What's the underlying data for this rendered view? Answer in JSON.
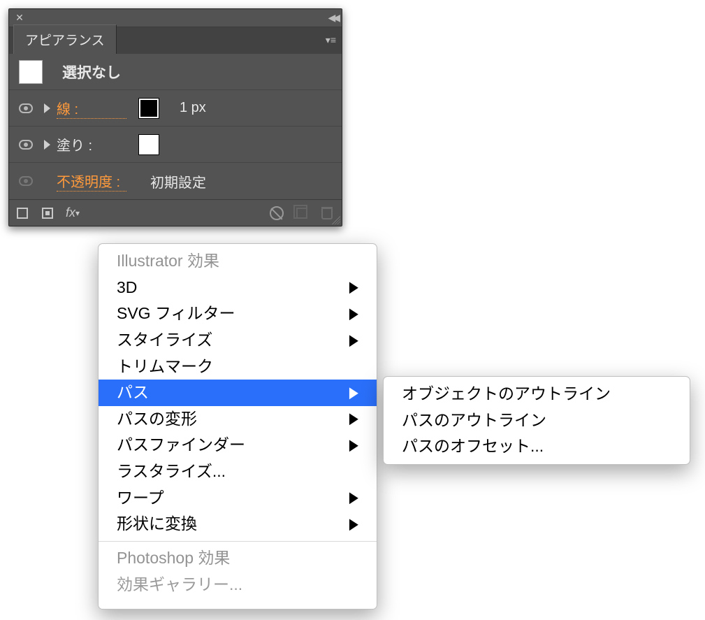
{
  "panel": {
    "tab_label": "アピアランス",
    "selection_label": "選択なし",
    "stroke": {
      "label": "線 :",
      "value": "1 px"
    },
    "fill": {
      "label": "塗り :"
    },
    "opacity": {
      "label": "不透明度 :",
      "value": "初期設定"
    },
    "fx_label": "fx"
  },
  "menu": {
    "section1_header": "Illustrator 効果",
    "items1": [
      {
        "label": "3D",
        "arrow": true
      },
      {
        "label": "SVG フィルター",
        "arrow": true
      },
      {
        "label": "スタイライズ",
        "arrow": true
      },
      {
        "label": "トリムマーク",
        "arrow": false
      },
      {
        "label": "パス",
        "arrow": true,
        "selected": true
      },
      {
        "label": "パスの変形",
        "arrow": true
      },
      {
        "label": "パスファインダー",
        "arrow": true
      },
      {
        "label": "ラスタライズ...",
        "arrow": false
      },
      {
        "label": "ワープ",
        "arrow": true
      },
      {
        "label": "形状に変換",
        "arrow": true
      }
    ],
    "section2_header": "Photoshop 効果",
    "items2": [
      {
        "label": "効果ギャラリー...",
        "arrow": false,
        "dim": true
      }
    ]
  },
  "submenu": {
    "items": [
      {
        "label": "オブジェクトのアウトライン"
      },
      {
        "label": "パスのアウトライン"
      },
      {
        "label": "パスのオフセット..."
      }
    ]
  }
}
